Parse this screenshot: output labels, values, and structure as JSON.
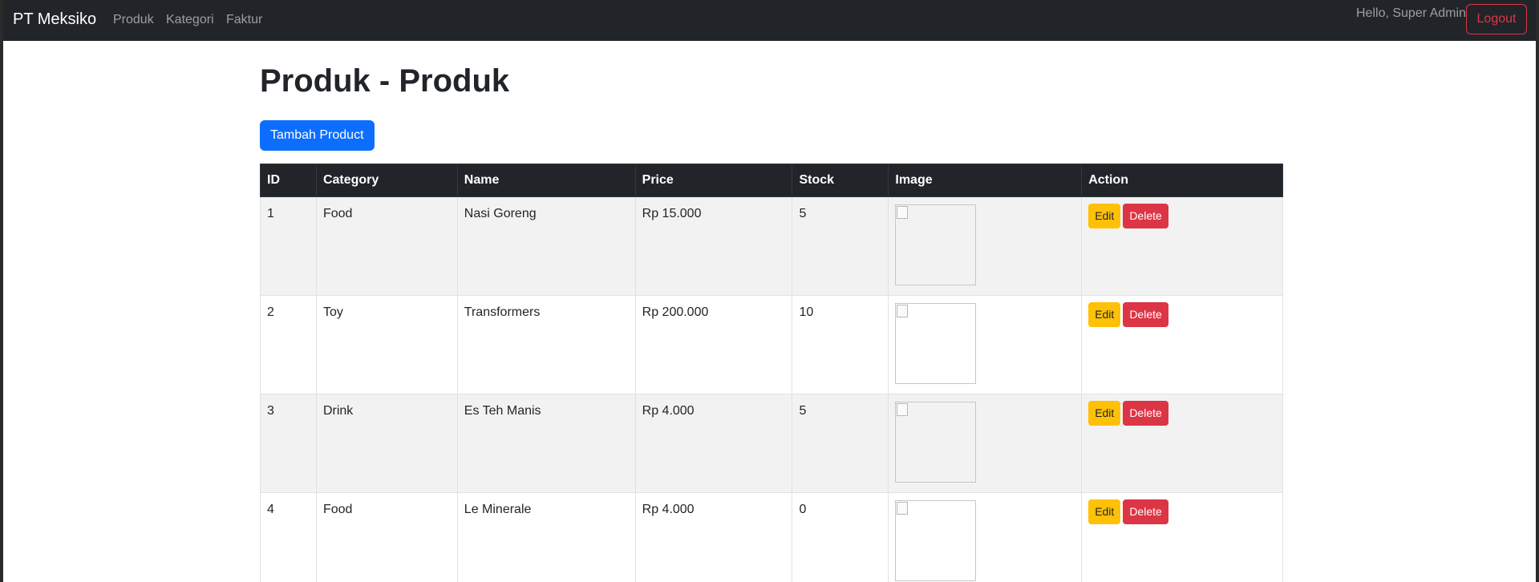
{
  "navbar": {
    "brand": "PT Meksiko",
    "links": [
      "Produk",
      "Kategori",
      "Faktur"
    ],
    "greeting": "Hello, Super Admin",
    "logout_label": "Logout"
  },
  "page": {
    "title": "Produk - Produk",
    "add_button": "Tambah Product"
  },
  "table": {
    "headers": [
      "ID",
      "Category",
      "Name",
      "Price",
      "Stock",
      "Image",
      "Action"
    ],
    "rows": [
      {
        "id": "1",
        "category": "Food",
        "name": "Nasi Goreng",
        "price": "Rp 15.000",
        "stock": "5"
      },
      {
        "id": "2",
        "category": "Toy",
        "name": "Transformers",
        "price": "Rp 200.000",
        "stock": "10"
      },
      {
        "id": "3",
        "category": "Drink",
        "name": "Es Teh Manis",
        "price": "Rp 4.000",
        "stock": "5"
      },
      {
        "id": "4",
        "category": "Food",
        "name": "Le Minerale",
        "price": "Rp 4.000",
        "stock": "0"
      }
    ],
    "edit_label": "Edit",
    "delete_label": "Delete"
  },
  "colors": {
    "navbar": "#212529",
    "primary": "#0d6efd",
    "warning": "#ffc107",
    "danger": "#dc3545"
  }
}
